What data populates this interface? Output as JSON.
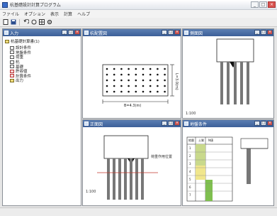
{
  "window": {
    "title": "杭基礎設計計算プログラム",
    "buttons": {
      "minimize": "_",
      "maximize": "□",
      "close": "×"
    }
  },
  "menu": [
    "ファイル",
    "オプション",
    "表示",
    "計算",
    "ヘルプ"
  ],
  "toolbar": [
    "new-icon",
    "save-icon",
    "undo-icon",
    "redo-icon",
    "table-icon",
    "settings-icon"
  ],
  "panes": {
    "tree": {
      "title": "入力",
      "root": "杭基礎計算書(1)",
      "items": [
        {
          "label": "設計条件",
          "icon": "doc"
        },
        {
          "label": "地盤条件",
          "icon": "doc"
        },
        {
          "label": "荷重",
          "icon": "doc"
        },
        {
          "label": "杭",
          "icon": "doc"
        },
        {
          "label": "基礎",
          "icon": "doc"
        },
        {
          "label": "許容値",
          "icon": "red"
        },
        {
          "label": "計算条件",
          "icon": "red"
        },
        {
          "label": "出力",
          "icon": "folder"
        }
      ]
    },
    "plan": {
      "title": "杭配置図",
      "width_dim": "B=4.3(m)",
      "height_dim": "L=3.0(m)"
    },
    "side": {
      "title": "側面図",
      "caption": "1:100"
    },
    "front": {
      "title": "正面図",
      "label": "荷重作用位置",
      "caption": "1:100"
    },
    "soil": {
      "title": "地盤条件",
      "headers": [
        "地層",
        "土質",
        "N値"
      ],
      "rows": [
        "1",
        "2",
        "3",
        "4",
        "5",
        "6",
        "7"
      ]
    }
  },
  "status": {
    "text": ""
  },
  "colors": {
    "title_bar": "#4a6ea8",
    "pile": "#707070",
    "soil_yellow": "#f0e68c",
    "soil_green": "#7fbf4f"
  }
}
